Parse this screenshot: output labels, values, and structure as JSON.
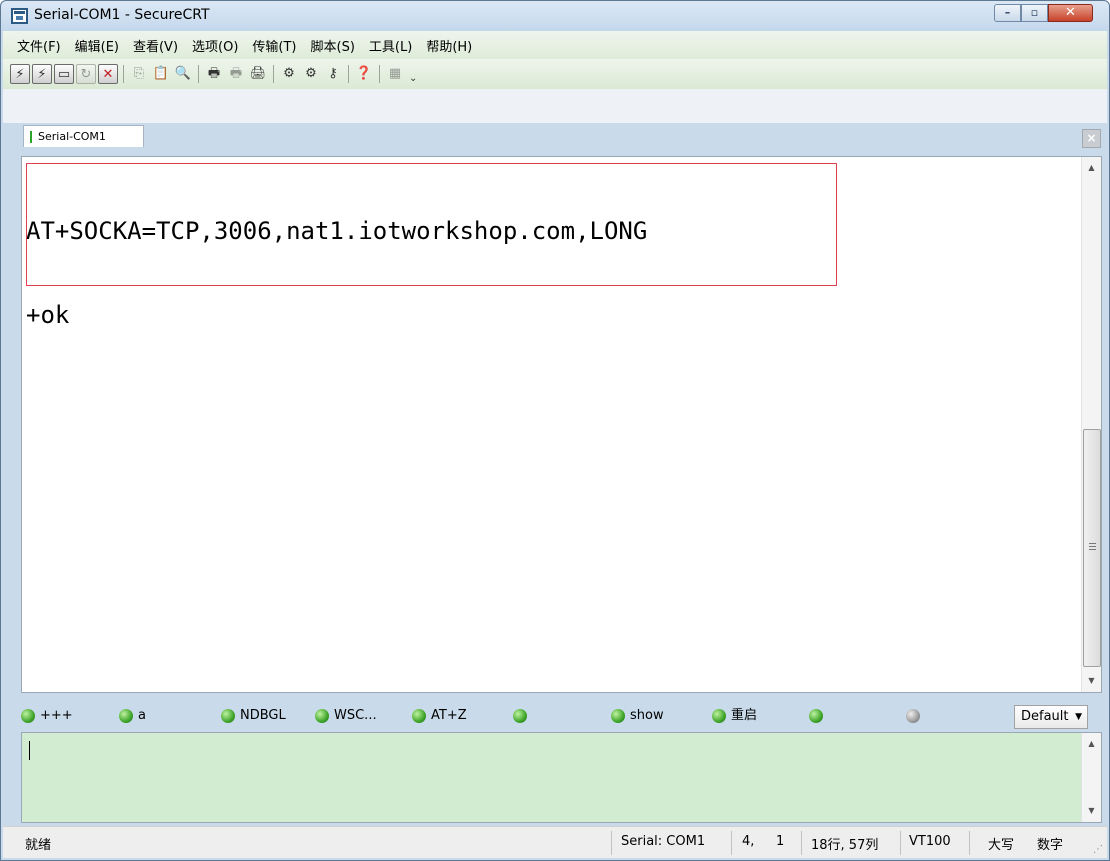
{
  "window": {
    "title": "Serial-COM1 - SecureCRT",
    "minimize": "–",
    "maximize": "▫",
    "close": "✕"
  },
  "menu": [
    "文件(F)",
    "编辑(E)",
    "查看(V)",
    "选项(O)",
    "传输(T)",
    "脚本(S)",
    "工具(L)",
    "帮助(H)"
  ],
  "toolbar": {
    "icons": [
      "connect-icon",
      "quick-connect-icon",
      "connect-in-tab-icon",
      "reconnect-icon",
      "disconnect-icon",
      "copy-icon",
      "paste-icon",
      "find-icon",
      "print-screen-icon",
      "print-selection-icon",
      "print-icon",
      "session-options-icon",
      "global-options-icon",
      "key-map-icon",
      "help-icon",
      "layout-icon"
    ],
    "more": "⌄"
  },
  "tab": {
    "label": "Serial-COM1",
    "close": "×"
  },
  "terminal": {
    "lines": [
      "AT+SOCKA=TCP,3006,nat1.iotworkshop.com,LONG",
      "+ok"
    ],
    "scroll_up": "▲",
    "scroll_down": "▼"
  },
  "button_bar": {
    "buttons": [
      "+++",
      "a",
      "NDBGL",
      "WSC...",
      "AT+Z",
      "",
      "show",
      "重启",
      "",
      ""
    ],
    "selector": "Default",
    "selector_caret": "▼"
  },
  "chat": {
    "value": "",
    "scroll_up": "▲",
    "scroll_down": "▼"
  },
  "status": {
    "ready": "就绪",
    "connection": "Serial: COM1",
    "cursor_row": "4,",
    "cursor_col": "1",
    "size": "18行, 57列",
    "emulation": "VT100",
    "caps": "大写",
    "num": "数字"
  }
}
